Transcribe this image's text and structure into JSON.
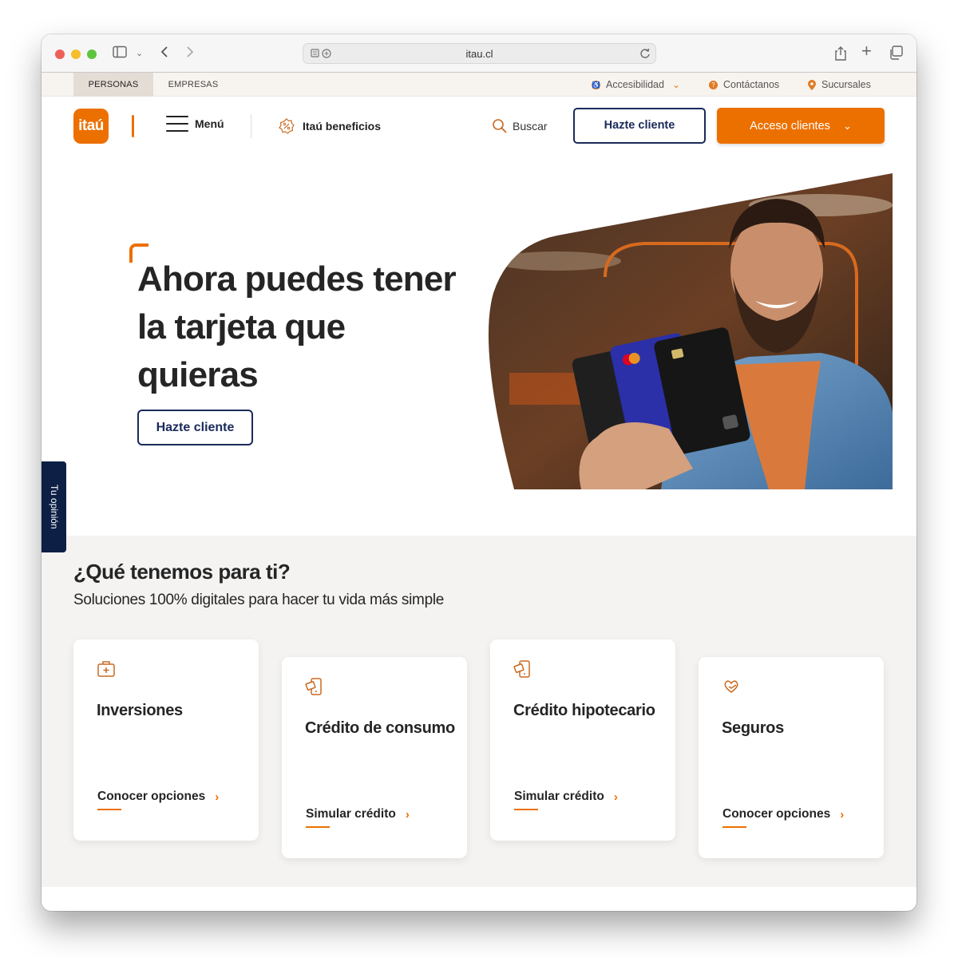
{
  "browser": {
    "url": "itau.cl"
  },
  "utility_bar": {
    "segments": [
      "PERSONAS",
      "EMPRESAS"
    ],
    "accessibility": "Accesibilidad",
    "contact": "Contáctanos",
    "branches": "Sucursales"
  },
  "nav": {
    "logo": "itaú",
    "menu": "Menú",
    "benefits": "Itaú beneficios",
    "search": "Buscar",
    "become_client": "Hazte cliente",
    "client_access": "Acceso clientes"
  },
  "hero": {
    "title": "Ahora puedes tener la tarjeta que quieras",
    "button": "Hazte cliente"
  },
  "feedback_tab": "Tu opinión",
  "section": {
    "title": "¿Qué tenemos para ti?",
    "subtitle": "Soluciones 100% digitales para hacer tu vida más simple",
    "cards": [
      {
        "title": "Inversiones",
        "link": "Conocer opciones",
        "icon": "briefcase-plus-icon"
      },
      {
        "title": "Crédito de consumo",
        "link": "Simular crédito",
        "icon": "phone-money-icon"
      },
      {
        "title": "Crédito hipotecario",
        "link": "Simular crédito",
        "icon": "phone-money-icon"
      },
      {
        "title": "Seguros",
        "link": "Conocer opciones",
        "icon": "heart-hand-icon"
      }
    ]
  },
  "colors": {
    "brand_orange": "#ec7000",
    "navy": "#1a2a5a"
  }
}
